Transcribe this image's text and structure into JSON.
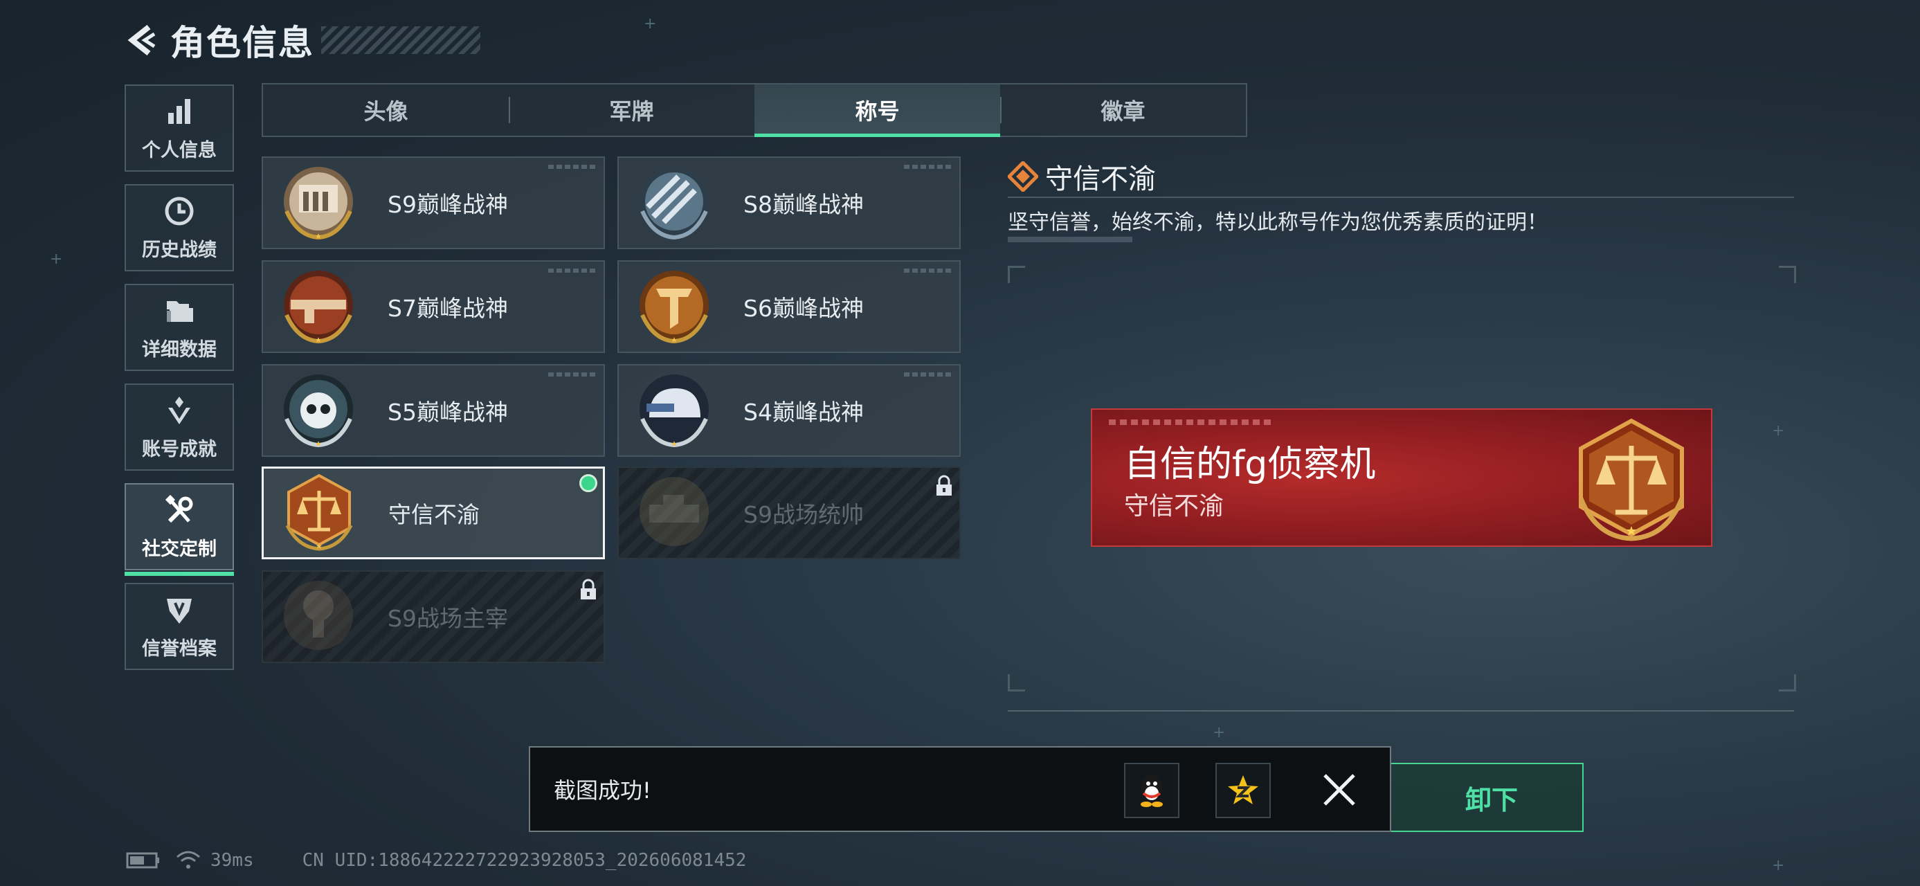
{
  "header": {
    "title": "角色信息"
  },
  "sidebar": {
    "items": [
      {
        "label": "个人信息",
        "icon": "bar-chart-icon"
      },
      {
        "label": "历史战绩",
        "icon": "clock-icon"
      },
      {
        "label": "详细数据",
        "icon": "folder-icon"
      },
      {
        "label": "账号成就",
        "icon": "achievement-icon"
      },
      {
        "label": "社交定制",
        "icon": "tools-icon",
        "active": true
      },
      {
        "label": "信誉档案",
        "icon": "shield-icon"
      }
    ]
  },
  "tabs": [
    {
      "label": "头像"
    },
    {
      "label": "军牌"
    },
    {
      "label": "称号",
      "active": true
    },
    {
      "label": "徽章"
    }
  ],
  "titles": [
    {
      "name": "S9巅峰战神",
      "state": "available"
    },
    {
      "name": "S8巅峰战神",
      "state": "available"
    },
    {
      "name": "S7巅峰战神",
      "state": "available"
    },
    {
      "name": "S6巅峰战神",
      "state": "available"
    },
    {
      "name": "S5巅峰战神",
      "state": "available"
    },
    {
      "name": "S4巅峰战神",
      "state": "available"
    },
    {
      "name": "守信不渝",
      "state": "selected"
    },
    {
      "name": "S9战场统帅",
      "state": "locked"
    },
    {
      "name": "S9战场主宰",
      "state": "locked"
    }
  ],
  "detail": {
    "title": "守信不渝",
    "description": "坚守信誉，始终不渝，特以此称号作为您优秀素质的证明！"
  },
  "banner": {
    "nickname": "自信的fg侦察机",
    "title": "守信不渝"
  },
  "action": {
    "unequip_label": "卸下"
  },
  "toast": {
    "message": "截图成功!",
    "share_targets": [
      "qq-icon",
      "qzone-icon"
    ]
  },
  "status": {
    "ping": "39ms",
    "uid": "CN UID:18864222272292392​8053_202606081452"
  },
  "colors": {
    "accent": "#4fe0a5",
    "banner_red": "#951f22",
    "selected_dot": "#3bd68c"
  }
}
